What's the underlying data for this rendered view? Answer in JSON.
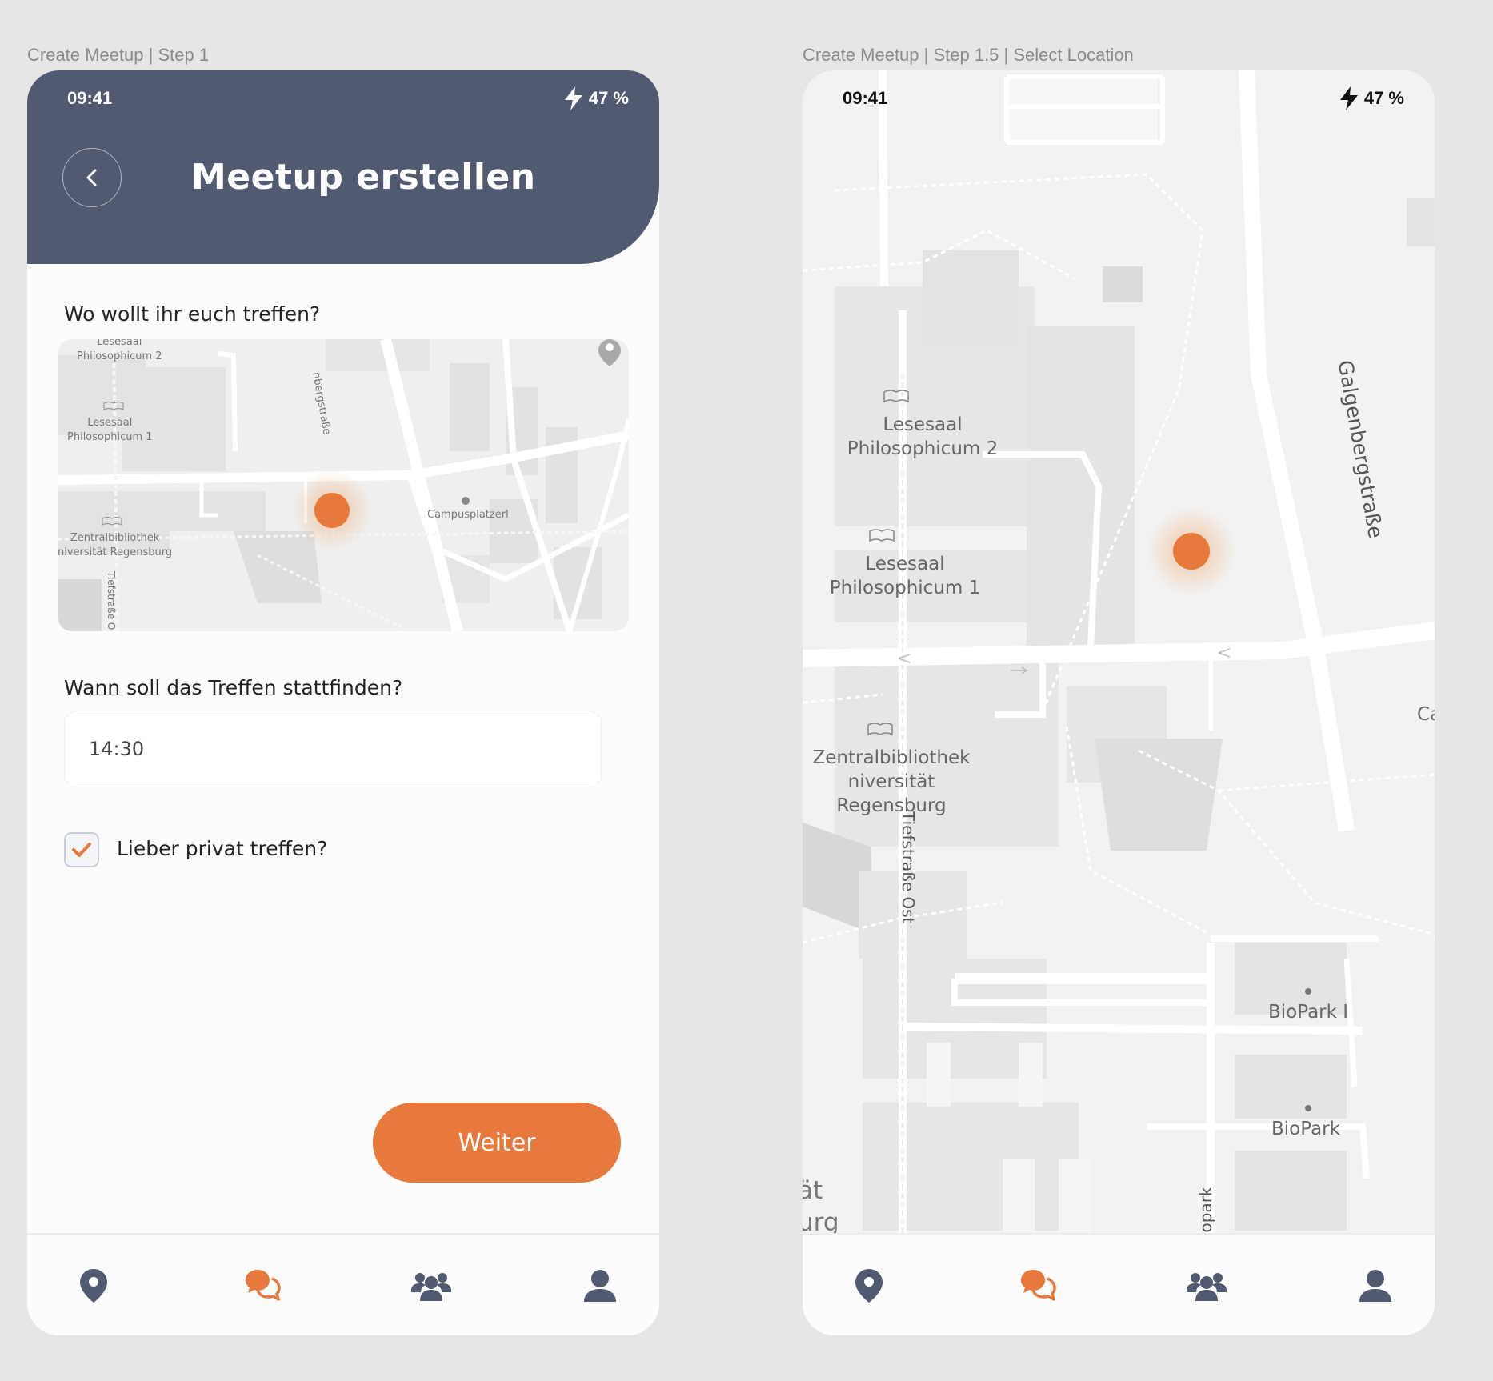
{
  "screens": [
    {
      "frame_label": "Create Meetup | Step 1",
      "status": {
        "time": "09:41",
        "battery": "47 %"
      },
      "title": "Meetup erstellen",
      "location_question": "Wo wollt ihr euch treffen?",
      "map_labels": {
        "lesesaal2_a": "Lesesaal",
        "lesesaal2_b": "Philosophicum 2",
        "lesesaal1_a": "Lesesaal",
        "lesesaal1_b": "Philosophicum 1",
        "zentral_a": "Zentralbibliothek",
        "zentral_b": "niversität Regensburg",
        "street": "nbergstraße",
        "campus": "Campusplatzerl",
        "tief": "Tiefstraße O"
      },
      "time_question": "Wann soll das Treffen stattfinden?",
      "time_value": "14:30",
      "private_label": "Lieber privat treffen?",
      "private_checked": true,
      "next_button": "Weiter"
    },
    {
      "frame_label": "Create Meetup | Step 1.5 | Select Location",
      "status": {
        "time": "09:41",
        "battery": "47 %"
      },
      "map_labels": {
        "lesesaal2_a": "Lesesaal",
        "lesesaal2_b": "Philosophicum 2",
        "lesesaal1_a": "Lesesaal",
        "lesesaal1_b": "Philosophicum 1",
        "zentral_a": "Zentralbibliothek",
        "zentral_b": "niversität Regensburg",
        "galgen": "Galgenbergstraße",
        "tiefstrasse": "Tiefstraße Ost",
        "biopark1": "BioPark I",
        "biopark": "BioPark",
        "biopark_street": "iopark",
        "ca": "Ca",
        "uni_a": "ät",
        "uni_b": "urg"
      }
    }
  ],
  "tabbar": {
    "items": [
      "map-pin-icon",
      "chat-bubbles-icon",
      "group-icon",
      "profile-icon"
    ],
    "active_index": 1
  },
  "colors": {
    "header": "#525a72",
    "accent": "#e6793b",
    "icon": "#525a72",
    "map_bg": "#f2f2f2",
    "road": "#ffffff",
    "building": "#e2e2e2"
  }
}
